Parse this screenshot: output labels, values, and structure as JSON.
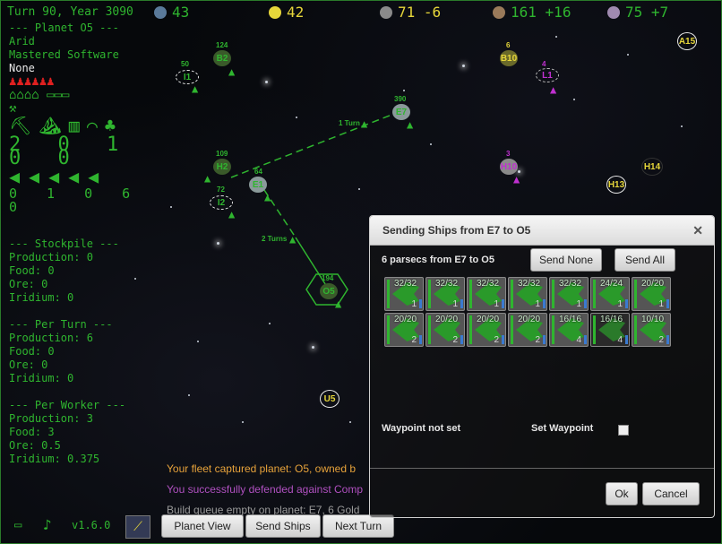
{
  "topbar": {
    "turn": "Turn 90, Year 3090",
    "population": "43",
    "gold": "42",
    "food": "71",
    "food_delta": "-6",
    "ore": "161",
    "ore_delta": "+16",
    "iridium": "75",
    "iridium_delta": "+7"
  },
  "planet_info": {
    "name": "--- Planet O5 ---",
    "climate": "Arid",
    "tech": "Mastered Software",
    "owner": "None",
    "buildings_counts": "2 0 1 0 0",
    "ship_counts": "0 1 0 6 0"
  },
  "stockpile": {
    "header": "--- Stockpile ---",
    "production": "Production: 0",
    "food": "Food: 0",
    "ore": "Ore: 0",
    "iridium": "Iridium: 0"
  },
  "per_turn": {
    "header": "--- Per Turn ---",
    "production": "Production: 6",
    "food": "Food: 0",
    "ore": "Ore: 0",
    "iridium": "Iridium: 0"
  },
  "per_worker": {
    "header": "--- Per Worker ---",
    "production": "Production: 3",
    "food": "Food: 3",
    "ore": "Ore: 0.5",
    "iridium": "Iridium: 0.375"
  },
  "map": {
    "planets": [
      {
        "name": "B2",
        "pop": "124"
      },
      {
        "name": "B10",
        "pop": "6"
      },
      {
        "name": "A15",
        "pop": ""
      },
      {
        "name": "I1",
        "pop": "50"
      },
      {
        "name": "E7",
        "pop": "390"
      },
      {
        "name": "H2",
        "pop": "109"
      },
      {
        "name": "E1",
        "pop": "64"
      },
      {
        "name": "I2",
        "pop": "72"
      },
      {
        "name": "H10",
        "pop": "3"
      },
      {
        "name": "H13",
        "pop": ""
      },
      {
        "name": "H14",
        "pop": ""
      },
      {
        "name": "O5",
        "pop": "194"
      },
      {
        "name": "U5",
        "pop": ""
      },
      {
        "name": "L1",
        "pop": "4"
      }
    ],
    "route_label_1": "1 Turn",
    "route_label_2": "2 Turns"
  },
  "messages": [
    "Your fleet captured planet: O5, owned b",
    "You successfully defended against Comp",
    "Build queue empty on planet: E7, 6 Gold"
  ],
  "bottom": {
    "version": "v1.6.0",
    "planet_view": "Planet View",
    "send_ships": "Send Ships",
    "next_turn": "Next Turn"
  },
  "dialog": {
    "title": "Sending Ships from E7 to O5",
    "distance": "6 parsecs from E7 to O5",
    "send_none": "Send None",
    "send_all": "Send All",
    "ships": [
      {
        "hp": "32/32",
        "count": "1"
      },
      {
        "hp": "32/32",
        "count": "1"
      },
      {
        "hp": "32/32",
        "count": "1"
      },
      {
        "hp": "32/32",
        "count": "1"
      },
      {
        "hp": "32/32",
        "count": "1"
      },
      {
        "hp": "24/24",
        "count": "1"
      },
      {
        "hp": "20/20",
        "count": "1"
      },
      {
        "hp": "20/20",
        "count": "2"
      },
      {
        "hp": "20/20",
        "count": "2"
      },
      {
        "hp": "20/20",
        "count": "2"
      },
      {
        "hp": "20/20",
        "count": "2"
      },
      {
        "hp": "16/16",
        "count": "4"
      },
      {
        "hp": "16/16",
        "count": "4"
      },
      {
        "hp": "10/10",
        "count": "2"
      }
    ],
    "waypoint_status": "Waypoint not set",
    "set_waypoint": "Set Waypoint",
    "ok": "Ok",
    "cancel": "Cancel"
  }
}
